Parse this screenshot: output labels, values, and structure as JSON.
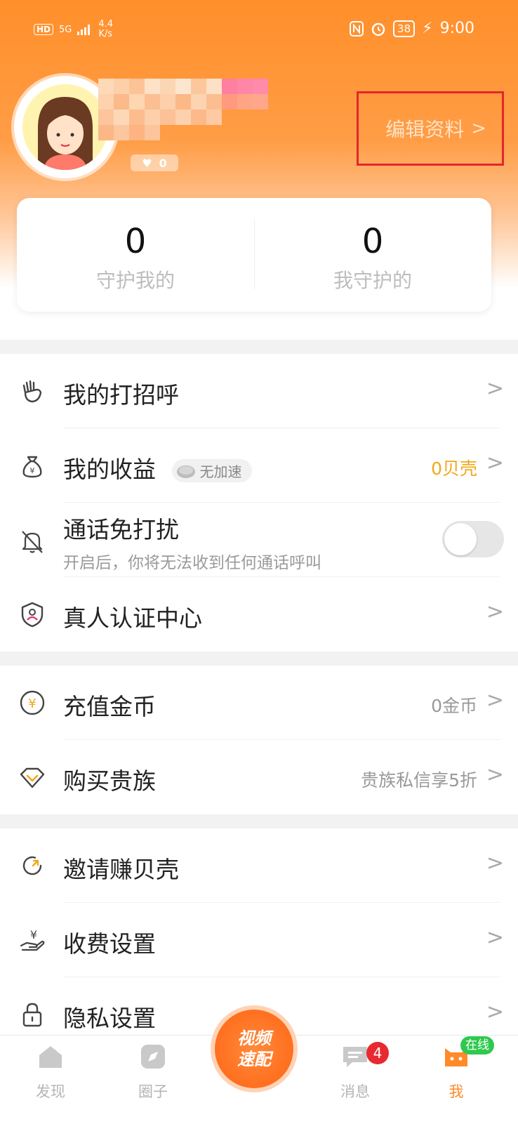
{
  "statusbar": {
    "hd": "HD",
    "net": "5G",
    "speed_top": "4.4",
    "speed_bottom": "K/s",
    "battery": "38",
    "time": "9:00"
  },
  "profile": {
    "likes": "0",
    "edit_label": "编辑资料",
    "edit_chevron": ">"
  },
  "stats": [
    {
      "value": "0",
      "label": "守护我的"
    },
    {
      "value": "0",
      "label": "我守护的"
    }
  ],
  "menu": {
    "greetings": {
      "label": "我的打招呼"
    },
    "earnings": {
      "label": "我的收益",
      "tag": "无加速",
      "value": "0贝壳"
    },
    "dnd": {
      "label": "通话免打扰",
      "subtitle": "开启后，你将无法收到任何通话呼叫",
      "enabled": false
    },
    "verify": {
      "label": "真人认证中心"
    },
    "recharge": {
      "label": "充值金币",
      "value": "0金币"
    },
    "noble": {
      "label": "购买贵族",
      "value": "贵族私信享5折"
    },
    "invite": {
      "label": "邀请赚贝壳"
    },
    "fees": {
      "label": "收费设置"
    },
    "privacy": {
      "label": "隐私设置"
    }
  },
  "chevron": ">",
  "tabbar": {
    "discover": "发现",
    "circle": "圈子",
    "video_match_line1": "视频",
    "video_match_line2": "速配",
    "messages": "消息",
    "messages_badge": "4",
    "me": "我",
    "online_badge": "在线"
  },
  "colors": {
    "accent": "#ff8a2a",
    "gold": "#f0a81c",
    "highlight_box": "#e4262c"
  }
}
